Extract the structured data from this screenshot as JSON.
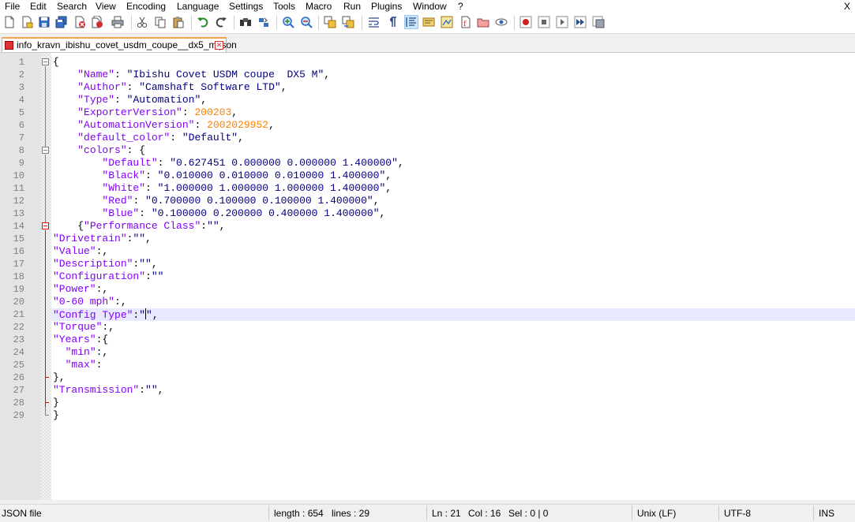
{
  "menu": {
    "items": [
      "File",
      "Edit",
      "Search",
      "View",
      "Encoding",
      "Language",
      "Settings",
      "Tools",
      "Macro",
      "Run",
      "Plugins",
      "Window",
      "?"
    ],
    "close": "X"
  },
  "toolbar": {
    "icons": [
      "new-file-icon",
      "open-file-icon",
      "save-icon",
      "save-all-icon",
      "close-icon",
      "close-all-icon",
      "print-icon",
      "cut-icon",
      "copy-icon",
      "paste-icon",
      "undo-icon",
      "redo-icon",
      "find-icon",
      "replace-icon",
      "zoom-in-icon",
      "zoom-out-icon",
      "sync-vertical-icon",
      "sync-horizontal-icon",
      "word-wrap-icon",
      "show-all-characters-icon",
      "indent-guide-icon",
      "user-defined-language-icon",
      "document-map-icon",
      "function-list-icon",
      "folder-as-workspace-icon",
      "monitoring-icon",
      "record-macro-icon",
      "stop-recording-icon",
      "playback-macro-icon",
      "run-macro-multiple-icon",
      "save-macro-icon"
    ]
  },
  "tab": {
    "filename": "info_kravn_ibishu_covet_usdm_coupe__dx5_m.json"
  },
  "editor": {
    "lines": [
      {
        "n": "1",
        "tokens": [
          {
            "t": "{",
            "c": ""
          }
        ]
      },
      {
        "n": "2",
        "tokens": [
          {
            "t": "    ",
            "c": ""
          },
          {
            "t": "\"Name\"",
            "c": "k"
          },
          {
            "t": ": ",
            "c": ""
          },
          {
            "t": "\"Ibishu Covet USDM coupe  DX5 M\"",
            "c": "s"
          },
          {
            "t": ",",
            "c": ""
          }
        ]
      },
      {
        "n": "3",
        "tokens": [
          {
            "t": "    ",
            "c": ""
          },
          {
            "t": "\"Author\"",
            "c": "k"
          },
          {
            "t": ": ",
            "c": ""
          },
          {
            "t": "\"Camshaft Software LTD\"",
            "c": "s"
          },
          {
            "t": ",",
            "c": ""
          }
        ]
      },
      {
        "n": "4",
        "tokens": [
          {
            "t": "    ",
            "c": ""
          },
          {
            "t": "\"Type\"",
            "c": "k"
          },
          {
            "t": ": ",
            "c": ""
          },
          {
            "t": "\"Automation\"",
            "c": "s"
          },
          {
            "t": ",",
            "c": ""
          }
        ]
      },
      {
        "n": "5",
        "tokens": [
          {
            "t": "    ",
            "c": ""
          },
          {
            "t": "\"ExporterVersion\"",
            "c": "k"
          },
          {
            "t": ": ",
            "c": ""
          },
          {
            "t": "200203",
            "c": "n"
          },
          {
            "t": ",",
            "c": ""
          }
        ]
      },
      {
        "n": "6",
        "tokens": [
          {
            "t": "    ",
            "c": ""
          },
          {
            "t": "\"AutomationVersion\"",
            "c": "k"
          },
          {
            "t": ": ",
            "c": ""
          },
          {
            "t": "2002029952",
            "c": "n"
          },
          {
            "t": ",",
            "c": ""
          }
        ]
      },
      {
        "n": "7",
        "tokens": [
          {
            "t": "    ",
            "c": ""
          },
          {
            "t": "\"default_color\"",
            "c": "k"
          },
          {
            "t": ": ",
            "c": ""
          },
          {
            "t": "\"Default\"",
            "c": "s"
          },
          {
            "t": ",",
            "c": ""
          }
        ]
      },
      {
        "n": "8",
        "tokens": [
          {
            "t": "    ",
            "c": ""
          },
          {
            "t": "\"colors\"",
            "c": "k"
          },
          {
            "t": ": {",
            "c": ""
          }
        ]
      },
      {
        "n": "9",
        "tokens": [
          {
            "t": "        ",
            "c": ""
          },
          {
            "t": "\"Default\"",
            "c": "k"
          },
          {
            "t": ": ",
            "c": ""
          },
          {
            "t": "\"0.627451 0.000000 0.000000 1.400000\"",
            "c": "s"
          },
          {
            "t": ",",
            "c": ""
          }
        ]
      },
      {
        "n": "10",
        "tokens": [
          {
            "t": "        ",
            "c": ""
          },
          {
            "t": "\"Black\"",
            "c": "k"
          },
          {
            "t": ": ",
            "c": ""
          },
          {
            "t": "\"0.010000 0.010000 0.010000 1.400000\"",
            "c": "s"
          },
          {
            "t": ",",
            "c": ""
          }
        ]
      },
      {
        "n": "11",
        "tokens": [
          {
            "t": "        ",
            "c": ""
          },
          {
            "t": "\"White\"",
            "c": "k"
          },
          {
            "t": ": ",
            "c": ""
          },
          {
            "t": "\"1.000000 1.000000 1.000000 1.400000\"",
            "c": "s"
          },
          {
            "t": ",",
            "c": ""
          }
        ]
      },
      {
        "n": "12",
        "tokens": [
          {
            "t": "        ",
            "c": ""
          },
          {
            "t": "\"Red\"",
            "c": "k"
          },
          {
            "t": ": ",
            "c": ""
          },
          {
            "t": "\"0.700000 0.100000 0.100000 1.400000\"",
            "c": "s"
          },
          {
            "t": ",",
            "c": ""
          }
        ]
      },
      {
        "n": "13",
        "tokens": [
          {
            "t": "        ",
            "c": ""
          },
          {
            "t": "\"Blue\"",
            "c": "k"
          },
          {
            "t": ": ",
            "c": ""
          },
          {
            "t": "\"0.100000 0.200000 0.400000 1.400000\"",
            "c": "s"
          },
          {
            "t": ",",
            "c": ""
          }
        ]
      },
      {
        "n": "14",
        "tokens": [
          {
            "t": "    {",
            "c": ""
          },
          {
            "t": "\"Performance Class\"",
            "c": "k"
          },
          {
            "t": ":",
            "c": ""
          },
          {
            "t": "\"\"",
            "c": "s"
          },
          {
            "t": ",",
            "c": ""
          }
        ]
      },
      {
        "n": "15",
        "tokens": [
          {
            "t": "\"Drivetrain\"",
            "c": "k"
          },
          {
            "t": ":",
            "c": ""
          },
          {
            "t": "\"\"",
            "c": "s"
          },
          {
            "t": ",",
            "c": ""
          }
        ]
      },
      {
        "n": "16",
        "tokens": [
          {
            "t": "\"Value\"",
            "c": "k"
          },
          {
            "t": ":,",
            "c": ""
          }
        ]
      },
      {
        "n": "17",
        "tokens": [
          {
            "t": "\"Description\"",
            "c": "k"
          },
          {
            "t": ":",
            "c": ""
          },
          {
            "t": "\"\"",
            "c": "s"
          },
          {
            "t": ",",
            "c": ""
          }
        ]
      },
      {
        "n": "18",
        "tokens": [
          {
            "t": "\"Configuration\"",
            "c": "k"
          },
          {
            "t": ":",
            "c": ""
          },
          {
            "t": "\"\"",
            "c": "s"
          }
        ]
      },
      {
        "n": "19",
        "tokens": [
          {
            "t": "\"Power\"",
            "c": "k"
          },
          {
            "t": ":,",
            "c": ""
          }
        ]
      },
      {
        "n": "20",
        "tokens": [
          {
            "t": "\"0-60 mph\"",
            "c": "k"
          },
          {
            "t": ":,",
            "c": ""
          }
        ]
      },
      {
        "n": "21",
        "tokens": [
          {
            "t": "\"Config Type\"",
            "c": "k"
          },
          {
            "t": ":",
            "c": ""
          },
          {
            "t": "\"",
            "c": "s"
          },
          {
            "t": "|",
            "c": "caret"
          },
          {
            "t": "\"",
            "c": "s"
          },
          {
            "t": ",",
            "c": ""
          }
        ]
      },
      {
        "n": "22",
        "tokens": [
          {
            "t": "\"Torque\"",
            "c": "k"
          },
          {
            "t": ":,",
            "c": ""
          }
        ]
      },
      {
        "n": "23",
        "tokens": [
          {
            "t": "\"Years\"",
            "c": "k"
          },
          {
            "t": ":{",
            "c": ""
          }
        ]
      },
      {
        "n": "24",
        "tokens": [
          {
            "t": "  ",
            "c": ""
          },
          {
            "t": "\"min\"",
            "c": "k"
          },
          {
            "t": ":,",
            "c": ""
          }
        ]
      },
      {
        "n": "25",
        "tokens": [
          {
            "t": "  ",
            "c": ""
          },
          {
            "t": "\"max\"",
            "c": "k"
          },
          {
            "t": ":",
            "c": ""
          }
        ]
      },
      {
        "n": "26",
        "tokens": [
          {
            "t": "},",
            "c": ""
          }
        ]
      },
      {
        "n": "27",
        "tokens": [
          {
            "t": "\"Transmission\"",
            "c": "k"
          },
          {
            "t": ":",
            "c": ""
          },
          {
            "t": "\"\"",
            "c": "s"
          },
          {
            "t": ",",
            "c": ""
          }
        ]
      },
      {
        "n": "28",
        "tokens": [
          {
            "t": "}",
            "c": ""
          }
        ]
      },
      {
        "n": "29",
        "tokens": [
          {
            "t": "}",
            "c": ""
          }
        ]
      }
    ]
  },
  "status": {
    "file_type": "JSON file",
    "length": "length : 654",
    "lines": "lines : 29",
    "ln": "Ln : 21",
    "col": "Col : 16",
    "sel": "Sel : 0 | 0",
    "eol": "Unix (LF)",
    "encoding": "UTF-8",
    "mode": "INS"
  }
}
